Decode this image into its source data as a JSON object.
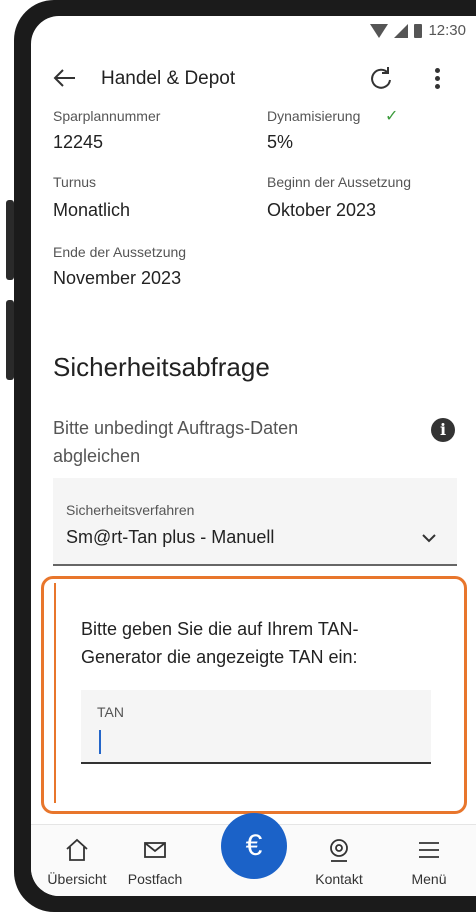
{
  "status_bar": {
    "time": "12:30"
  },
  "app_bar": {
    "title": "Handel & Depot"
  },
  "details": {
    "sparplan_label": "Sparplannummer",
    "sparplan_value": "12245",
    "dynamisierung_label": "Dynamisierung",
    "dynamisierung_value": "5%",
    "turnus_label": "Turnus",
    "turnus_value": "Monatlich",
    "beginn_label": "Beginn der Aussetzung",
    "beginn_value": "Oktober 2023",
    "ende_label": "Ende der Aussetzung",
    "ende_value": "November 2023"
  },
  "security": {
    "title": "Sicherheitsabfrage",
    "hint": "Bitte unbedingt Auftrags-Daten abgleichen",
    "method_label": "Sicherheitsverfahren",
    "method_value": "Sm@rt-Tan plus - Manuell",
    "tan_instruction": "Bitte geben Sie die auf Ihrem TAN-Generator die angezeigte TAN ein:",
    "tan_label": "TAN",
    "tan_value": ""
  },
  "nav": {
    "items": [
      {
        "label": "Übersicht",
        "icon": "home-icon"
      },
      {
        "label": "Postfach",
        "icon": "mail-icon"
      },
      {
        "label": "",
        "icon": "euro-icon"
      },
      {
        "label": "Kontakt",
        "icon": "contact-icon"
      },
      {
        "label": "Menü",
        "icon": "menu-icon"
      }
    ],
    "fab_symbol": "€"
  },
  "colors": {
    "accent_orange": "#e8762c",
    "primary_blue": "#1b62c8",
    "check_green": "#3c9b3c"
  }
}
